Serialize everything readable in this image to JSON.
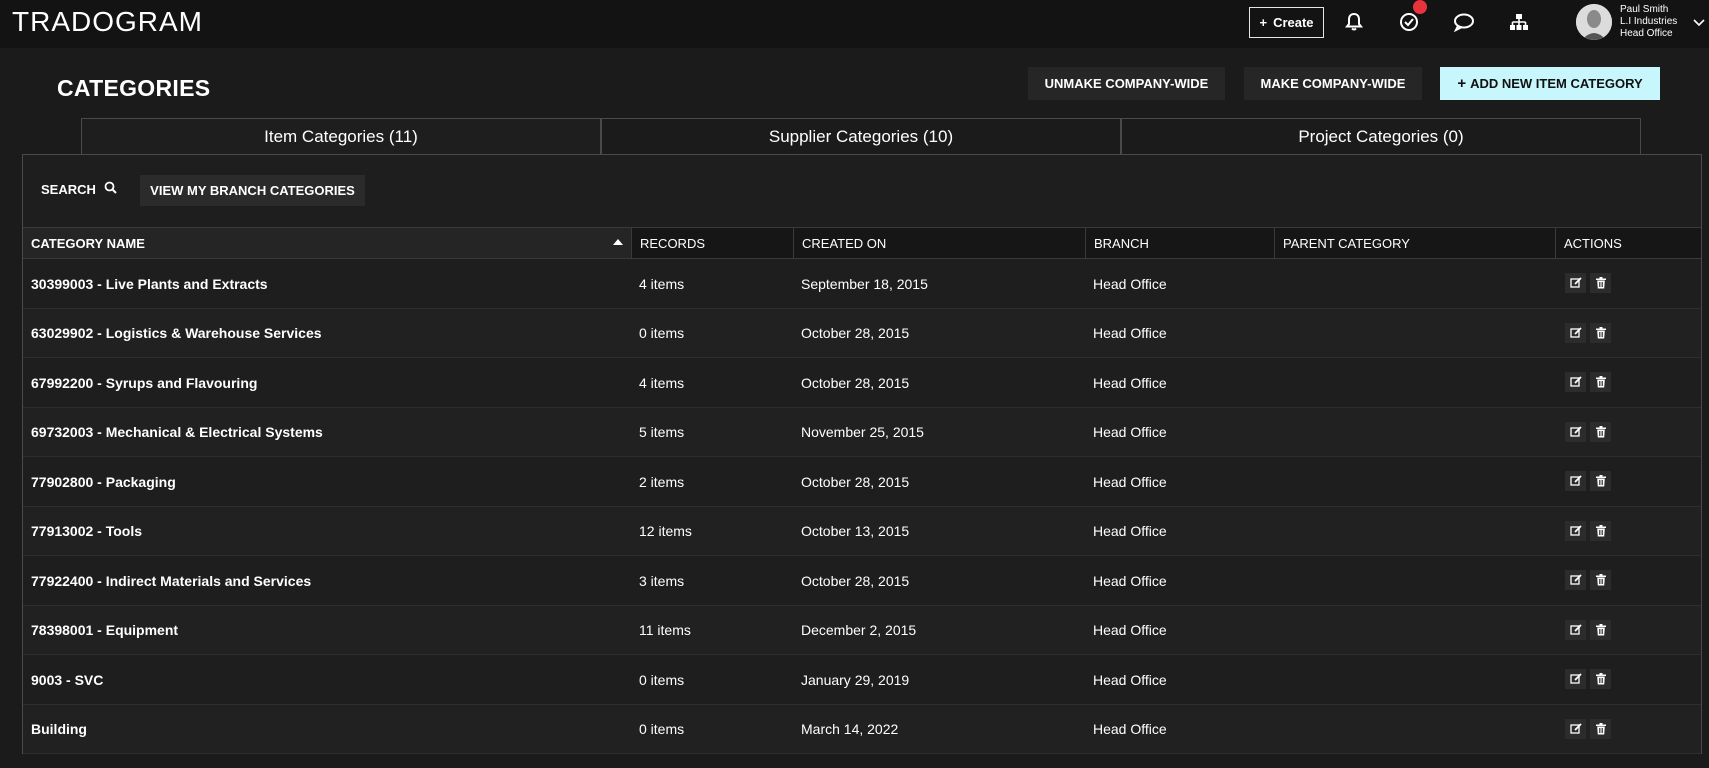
{
  "app": {
    "logo_text": "TRADOGRAM"
  },
  "topbar": {
    "create_label": "Create",
    "create_plus": "+",
    "user": {
      "name": "Paul Smith",
      "company": "L.I Industries",
      "office": "Head Office"
    }
  },
  "page": {
    "title": "CATEGORIES",
    "buttons": {
      "unmake": "UNMAKE COMPANY-WIDE",
      "make": "MAKE COMPANY-WIDE",
      "add": "ADD NEW ITEM CATEGORY",
      "add_plus": "+"
    }
  },
  "tabs": [
    {
      "label": "Item Categories (11)"
    },
    {
      "label": "Supplier Categories (10)"
    },
    {
      "label": "Project Categories (0)"
    }
  ],
  "toolbar": {
    "search_label": "SEARCH",
    "view_branch_label": "VIEW MY BRANCH CATEGORIES"
  },
  "table": {
    "headers": {
      "name": "CATEGORY NAME",
      "records": "RECORDS",
      "created": "CREATED ON",
      "branch": "BRANCH",
      "parent": "PARENT CATEGORY",
      "actions": "ACTIONS"
    },
    "rows": [
      {
        "name": "30399003 - Live Plants and Extracts",
        "records": "4 items",
        "created": "September 18, 2015",
        "branch": "Head Office",
        "parent": ""
      },
      {
        "name": "63029902 - Logistics & Warehouse Services",
        "records": "0 items",
        "created": "October 28, 2015",
        "branch": "Head Office",
        "parent": ""
      },
      {
        "name": "67992200 - Syrups and Flavouring",
        "records": "4 items",
        "created": "October 28, 2015",
        "branch": "Head Office",
        "parent": ""
      },
      {
        "name": "69732003 - Mechanical & Electrical Systems",
        "records": "5 items",
        "created": "November 25, 2015",
        "branch": "Head Office",
        "parent": ""
      },
      {
        "name": "77902800 - Packaging",
        "records": "2 items",
        "created": "October 28, 2015",
        "branch": "Head Office",
        "parent": ""
      },
      {
        "name": "77913002 - Tools",
        "records": "12 items",
        "created": "October 13, 2015",
        "branch": "Head Office",
        "parent": ""
      },
      {
        "name": "77922400 - Indirect Materials and Services",
        "records": "3 items",
        "created": "October 28, 2015",
        "branch": "Head Office",
        "parent": ""
      },
      {
        "name": "78398001 - Equipment",
        "records": "11 items",
        "created": "December 2, 2015",
        "branch": "Head Office",
        "parent": ""
      },
      {
        "name": "9003 - SVC",
        "records": "0 items",
        "created": "January 29, 2019",
        "branch": "Head Office",
        "parent": ""
      },
      {
        "name": "Building",
        "records": "0 items",
        "created": "March 14, 2022",
        "branch": "Head Office",
        "parent": ""
      }
    ]
  },
  "icons": {
    "notifications": "bell-icon",
    "tasks": "check-circle-icon",
    "messages": "chat-bubble-icon",
    "org": "org-chart-icon",
    "search": "search-icon",
    "edit": "edit-icon",
    "delete": "trash-icon"
  },
  "colors": {
    "accent_button": "#c7f6fc",
    "badge": "#e8333c",
    "background": "#1b1b1c"
  }
}
